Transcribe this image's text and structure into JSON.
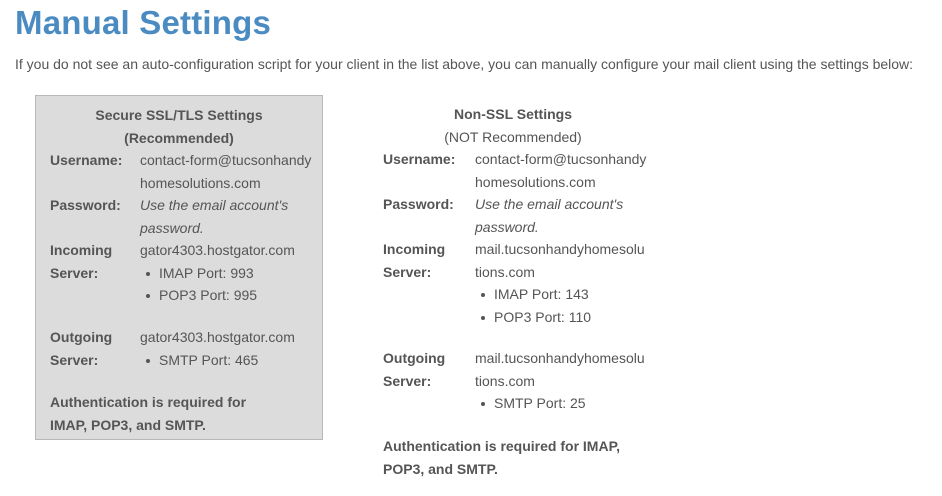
{
  "page": {
    "title": "Manual Settings",
    "intro": "If you do not see an auto-configuration script for your client in the list above, you can manually configure your mail client using the settings below:"
  },
  "ssl": {
    "heading_line1": "Secure SSL/TLS Settings",
    "heading_line2": "(Recommended)",
    "username_label": "Username:",
    "username_value": "contact-form@tucsonhandyhomesolutions.com",
    "password_label": "Password:",
    "password_value": "Use the email account's password.",
    "incoming_label_1": "Incoming",
    "incoming_label_2": "Server:",
    "incoming_server": "gator4303.hostgator.com",
    "incoming_ports": [
      "IMAP Port: 993",
      "POP3 Port: 995"
    ],
    "outgoing_label_1": "Outgoing",
    "outgoing_label_2": "Server:",
    "outgoing_server": "gator4303.hostgator.com",
    "outgoing_ports": [
      "SMTP Port: 465"
    ],
    "auth_line1": "Authentication is required for",
    "auth_line2": "IMAP, POP3, and SMTP."
  },
  "nonssl": {
    "heading_line1": "Non-SSL Settings",
    "heading_line2": "(NOT Recommended)",
    "username_label": "Username:",
    "username_value": "contact-form@tucsonhandyhomesolutions.com",
    "password_label": "Password:",
    "password_value": "Use the email account's password.",
    "incoming_label_1": "Incoming",
    "incoming_label_2": "Server:",
    "incoming_server": "mail.tucsonhandyhomesolutions.com",
    "incoming_ports": [
      "IMAP Port: 143",
      "POP3 Port: 110"
    ],
    "outgoing_label_1": "Outgoing",
    "outgoing_label_2": "Server:",
    "outgoing_server": "mail.tucsonhandyhomesolutions.com",
    "outgoing_ports": [
      "SMTP Port: 25"
    ],
    "auth_line1": "Authentication is required for IMAP,",
    "auth_line2": "POP3, and SMTP."
  }
}
